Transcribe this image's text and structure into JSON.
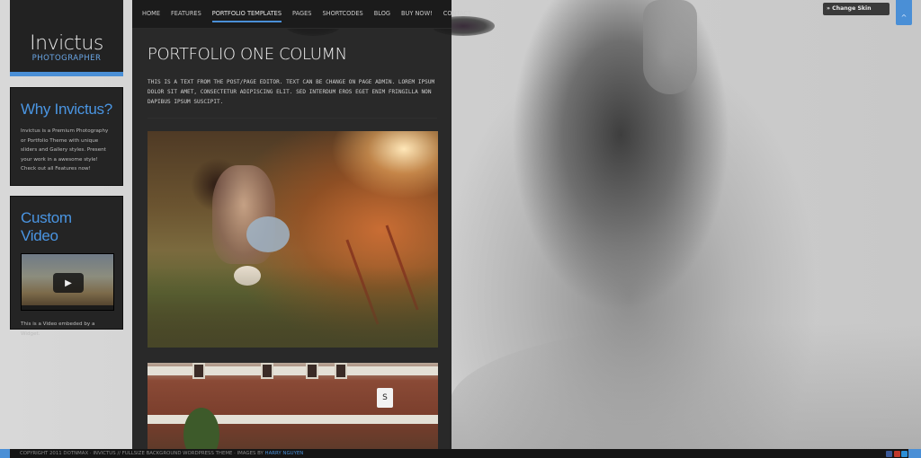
{
  "logo": {
    "title": "Invictus",
    "subtitle": "PHOTOGRAPHER"
  },
  "nav": {
    "items": [
      {
        "label": "HOME",
        "active": false
      },
      {
        "label": "FEATURES",
        "active": false
      },
      {
        "label": "PORTFOLIO TEMPLATES",
        "active": true
      },
      {
        "label": "PAGES",
        "active": false
      },
      {
        "label": "SHORTCODES",
        "active": false
      },
      {
        "label": "BLOG",
        "active": false
      },
      {
        "label": "BUY NOW!",
        "active": false
      },
      {
        "label": "CONTACT",
        "active": false
      }
    ]
  },
  "widgets": {
    "why": {
      "title": "Why Invictus?",
      "text": "Invictus is a Premium Photography or Portfolio Theme with unique sliders and Gallery styles. Present your work in a awesome style! Check out all Features now!"
    },
    "video": {
      "title": "Custom Video",
      "caption": "This is a Video embeded by a Widget.",
      "play_icon": "play-icon"
    }
  },
  "main": {
    "title": "PORTFOLIO ONE COLUMN",
    "intro": "THIS IS A TEXT FROM THE POST/PAGE EDITOR. TEXT CAN BE CHANGE ON PAGE ADMIN. LOREM IPSUM DOLOR SIT AMET, CONSECTETUR ADIPISCING ELIT. SED INTERDUM EROS EGET ENIM FRINGILLA NON DAPIBUS IPSUM SUSCIPIT."
  },
  "skin": {
    "label": "» Change Skin",
    "toggle_icon": "chevron-up-icon"
  },
  "footer": {
    "text": "COPYRIGHT 2011 DOTNMAX · INVICTUS // FULLSIZE BACKGROUND WORDPRESS THEME · IMAGES BY",
    "link": "HARRY NGUYEN"
  },
  "colors": {
    "accent": "#4a8fd6",
    "panel": "#242424",
    "nav": "#1b1b1b"
  }
}
